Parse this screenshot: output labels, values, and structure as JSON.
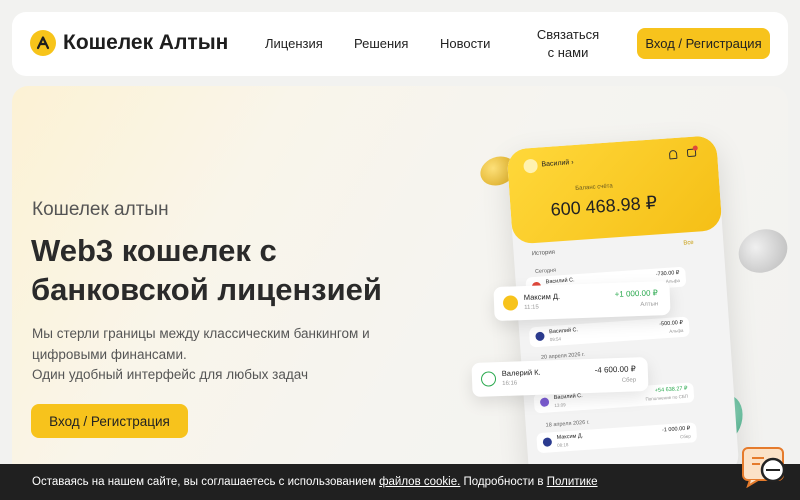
{
  "header": {
    "brand": "Кошелек Алтын",
    "nav": [
      "Лицензия",
      "Решения",
      "Новости"
    ],
    "contact": "Связаться с нами",
    "cta": "Вход / Регистрация"
  },
  "hero": {
    "kicker": "Кошелек алтын",
    "title": "Web3 кошелек с банковской лицензией",
    "description": [
      "Мы стерли границы между классическим банкингом и цифровыми финансами.",
      "Один удобный интерфейс для любых задач"
    ],
    "cta": "Вход / Регистрация"
  },
  "phone": {
    "user": "Василий ›",
    "balance_label": "Баланс счёта",
    "balance": "600 468.98 ₽",
    "history_label": "История",
    "all_label": "Все",
    "today_label": "Сегодня",
    "date2": "20 апреля 2026 г.",
    "date3": "18 апреля 2026 г.",
    "rows": [
      {
        "name": "Василий С.",
        "time": "19:18",
        "amount": "-730.00 ₽",
        "bank": "Альфа"
      },
      {
        "name": "Василий С.",
        "time": "09:54",
        "amount": "-500.00 ₽",
        "bank": "Альфа"
      },
      {
        "name": "Василий С.",
        "time": "13:09",
        "amount": "+54 638.27 ₽",
        "bank": "Пополнение по СБП"
      },
      {
        "name": "Максим Д.",
        "time": "08:18",
        "amount": "-1 000.00 ₽",
        "bank": "Сбер"
      }
    ],
    "float_cards": [
      {
        "name": "Максим Д.",
        "time": "11:15",
        "amount": "+1 000.00 ₽",
        "bank": "Алтын",
        "color": "#2aa94e"
      },
      {
        "name": "Валерий К.",
        "time": "16:16",
        "amount": "-4 600.00 ₽",
        "bank": "Сбер",
        "color": "#222222"
      }
    ]
  },
  "cookie": {
    "prefix": "Оставаясь на нашем сайте, вы соглашаетесь с использованием ",
    "link1": "файлов cookie.",
    "middle": " Подробности в ",
    "link2": "Политике"
  },
  "colors": {
    "accent": "#f7c31c",
    "cookie_bg": "#202020"
  }
}
